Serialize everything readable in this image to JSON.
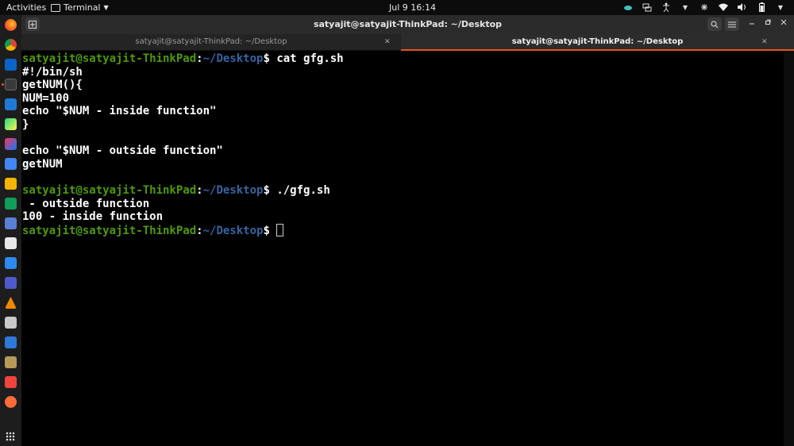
{
  "topbar": {
    "activities": "Activities",
    "app_menu": "Terminal",
    "clock": "Jul 9  16:14",
    "tray_icons": [
      "cloud-icon",
      "screen-icon",
      "accessibility-icon",
      "chevron-down-icon",
      "network-icon",
      "wifi-icon",
      "volume-icon",
      "battery-icon",
      "chevron-down-icon"
    ]
  },
  "dock": {
    "items": [
      "firefox",
      "chrome",
      "outlook",
      "terminal",
      "vscode",
      "pycharm",
      "intellij",
      "docs",
      "slides",
      "sheets",
      "screenshot",
      "text-editor",
      "whiteboard",
      "teams",
      "vlc",
      "files",
      "wps-writer",
      "archive",
      "anydesk",
      "postman"
    ]
  },
  "window": {
    "title": "satyajit@satyajit-ThinkPad: ~/Desktop",
    "tabs": [
      {
        "label": "satyajit@satyajit-ThinkPad: ~/Desktop",
        "active": false
      },
      {
        "label": "satyajit@satyajit-ThinkPad: ~/Desktop",
        "active": true
      }
    ]
  },
  "terminal": {
    "user_host": "satyajit@satyajit-ThinkPad",
    "path": "~/Desktop",
    "lines": [
      {
        "prompt": true,
        "cmd": " cat gfg.sh"
      },
      {
        "text": "#!/bin/sh"
      },
      {
        "text": "getNUM(){"
      },
      {
        "text": "NUM=100"
      },
      {
        "text": "echo \"$NUM - inside function\""
      },
      {
        "text": "}"
      },
      {
        "text": ""
      },
      {
        "text": "echo \"$NUM - outside function\""
      },
      {
        "text": "getNUM"
      },
      {
        "text": ""
      },
      {
        "prompt": true,
        "cmd": " ./gfg.sh"
      },
      {
        "text": " - outside function"
      },
      {
        "text": "100 - inside function"
      },
      {
        "prompt": true,
        "cmd": " ",
        "cursor": true
      }
    ]
  },
  "colors": {
    "user_host": "#4e9a06",
    "path": "#3465a4",
    "accent": "#e95420"
  }
}
